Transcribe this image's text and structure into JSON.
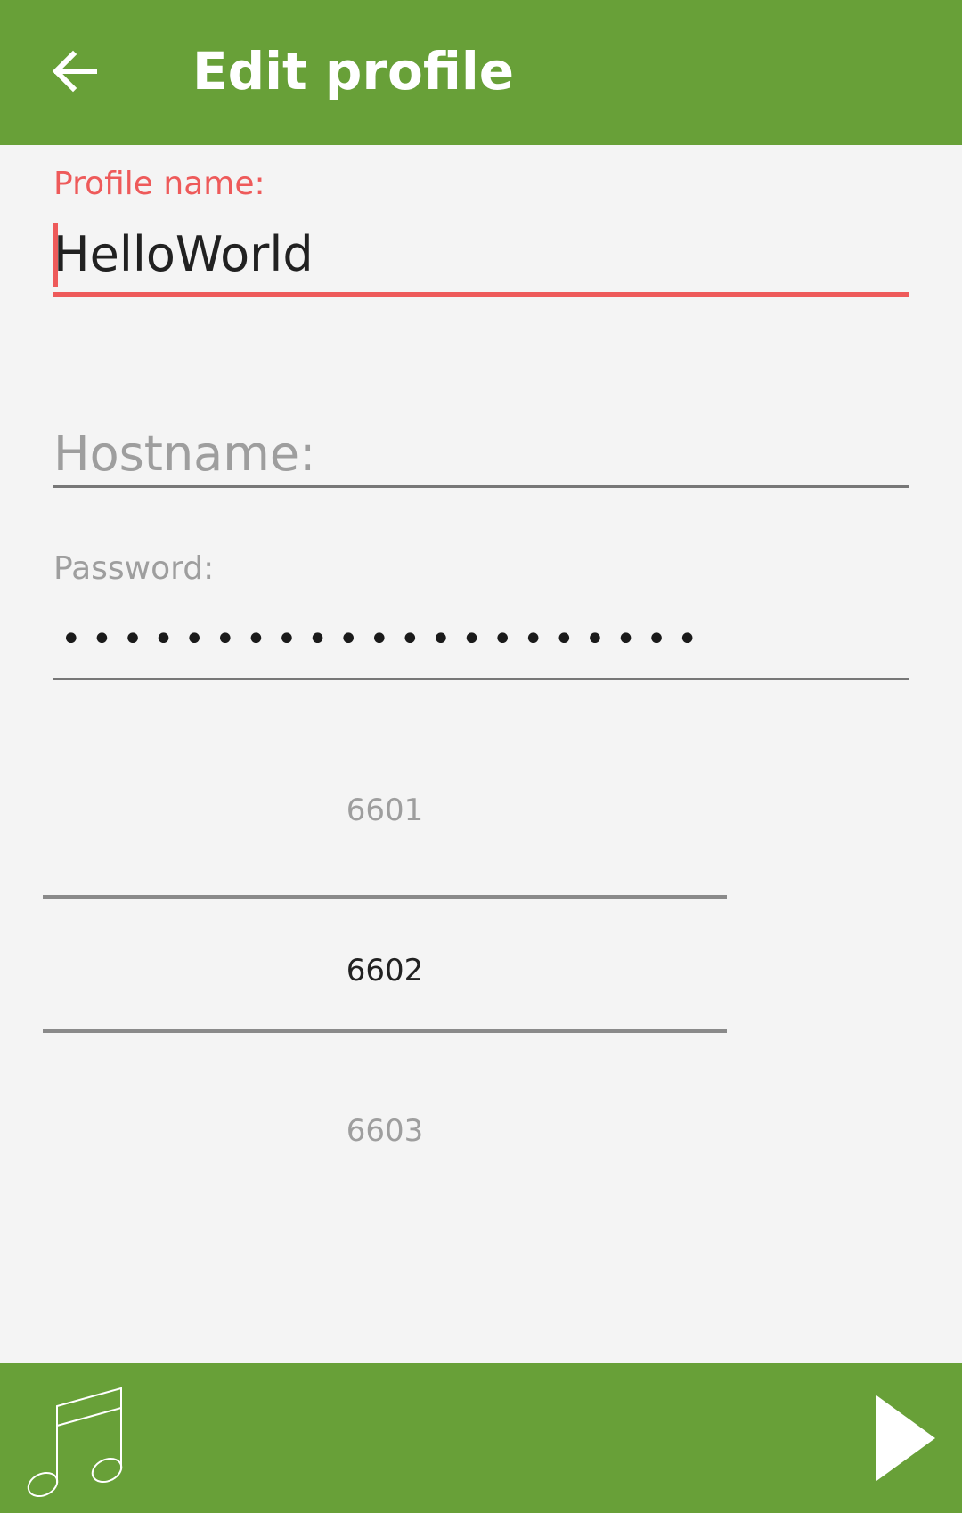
{
  "app_bar": {
    "title": "Edit profile",
    "back_icon": "arrow-back-icon",
    "background_color": "#68a038"
  },
  "form": {
    "profile_name": {
      "label": "Profile name:",
      "value": "HelloWorld",
      "accent_color": "#ee5a5a"
    },
    "hostname": {
      "placeholder": "Hostname:",
      "value": ""
    },
    "password": {
      "label": "Password:",
      "masked_value": "•••••••••••••••••••••"
    }
  },
  "port_picker": {
    "previous": "6601",
    "selected": "6602",
    "next": "6603"
  },
  "bottom_bar": {
    "left_icon": "music-note-icon",
    "right_icon": "play-icon",
    "background_color": "#68a038"
  }
}
